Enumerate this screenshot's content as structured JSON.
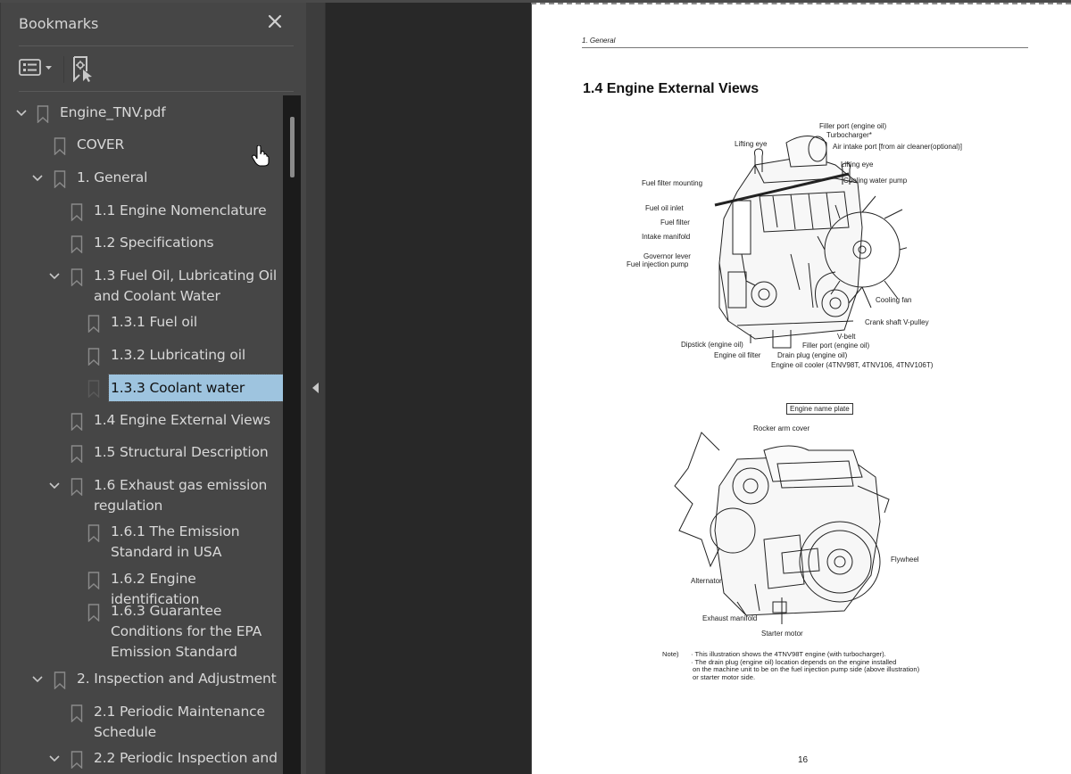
{
  "sidebar": {
    "title": "Bookmarks",
    "close_icon": "close-icon",
    "toolbar": {
      "options_icon": "list-options-icon",
      "new_bookmark_icon": "add-bookmark-icon"
    },
    "items": [
      {
        "label": "Engine_TNV.pdf",
        "level": 0,
        "expanded": true,
        "has_children": true
      },
      {
        "label": "COVER",
        "level": 1,
        "expanded": false,
        "has_children": false
      },
      {
        "label": "1. General",
        "level": 1,
        "expanded": true,
        "has_children": true
      },
      {
        "label": "1.1 Engine Nomenclature",
        "level": 2,
        "has_children": false
      },
      {
        "label": "1.2 Specifications",
        "level": 2,
        "has_children": false
      },
      {
        "label": "1.3 Fuel Oil, Lubricating Oil\nand Coolant Water",
        "level": 2,
        "expanded": true,
        "has_children": true
      },
      {
        "label": "1.3.1 Fuel oil",
        "level": 3,
        "has_children": false
      },
      {
        "label": "1.3.2 Lubricating oil",
        "level": 3,
        "has_children": false
      },
      {
        "label": "1.3.3 Coolant water",
        "level": 3,
        "has_children": false,
        "selected": true
      },
      {
        "label": "1.4 Engine External Views",
        "level": 2,
        "has_children": false
      },
      {
        "label": "1.5 Structural Description",
        "level": 2,
        "has_children": false
      },
      {
        "label": "1.6 Exhaust gas emission\nregulation",
        "level": 2,
        "expanded": true,
        "has_children": true
      },
      {
        "label": "1.6.1 The Emission\nStandard in USA",
        "level": 3,
        "has_children": false
      },
      {
        "label": "1.6.2 Engine identification",
        "level": 3,
        "has_children": false
      },
      {
        "label": "1.6.3 Guarantee\nConditions for the EPA\nEmission Standard",
        "level": 3,
        "has_children": false
      },
      {
        "label": "2. Inspection and Adjustment",
        "level": 1,
        "expanded": true,
        "has_children": true
      },
      {
        "label": "2.1 Periodic Maintenance\nSchedule",
        "level": 2,
        "has_children": false
      },
      {
        "label": "2.2 Periodic Inspection and",
        "level": 2,
        "expanded": true,
        "has_children": true
      }
    ],
    "selection_color": "#9ec4df"
  },
  "page": {
    "running_head": "1. General",
    "section_title": "1.4 Engine External Views",
    "figure1_callouts": [
      "Filler port (engine oil)",
      "Turbocharger*",
      "Air intake port [from air cleaner(optional)]",
      "Lifting eye",
      "Lifting eye",
      "Cooling water pump",
      "Fuel filter mounting",
      "Fuel oil inlet",
      "Fuel filter",
      "Intake manifold",
      "Governor lever",
      "Fuel injection pump",
      "Cooling fan",
      "Crank shaft V-pulley",
      "V-belt",
      "Filler port (engine oil)",
      "Dipstick (engine oil)",
      "Engine oil filter",
      "Drain plug  (engine oil)",
      "Engine oil cooler (4TNV98T, 4TNV106, 4TNV106T)"
    ],
    "figure2_callouts": [
      "Engine name plate",
      "Rocker arm cover",
      "Flywheel",
      "Alternator",
      "Exhaust manifold",
      "Starter motor"
    ],
    "note_label": "Note)",
    "note_lines": [
      "· This illustration shows the 4TNV98T engine (with turbocharger).",
      "· The drain plug (engine oil) location depends on the engine installed",
      "  on the machine unit to be on the fuel injection pump side (above illustration)",
      "  or starter motor side."
    ],
    "page_number": "16"
  }
}
